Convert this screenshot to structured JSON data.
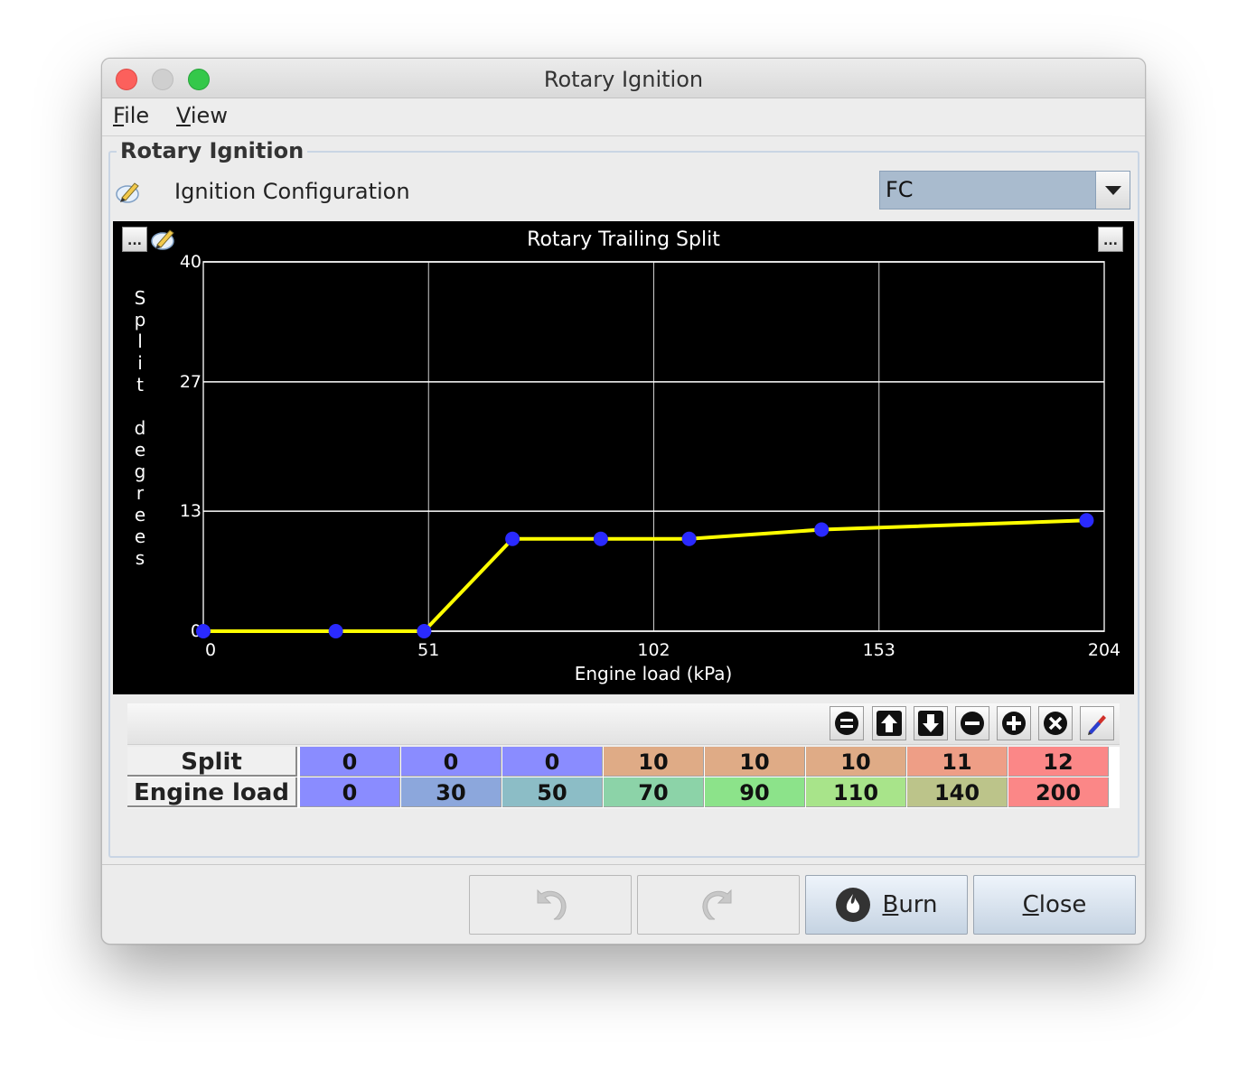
{
  "window": {
    "title": "Rotary Ignition"
  },
  "menu": {
    "items": [
      {
        "mnemonic": "F",
        "rest": "ile"
      },
      {
        "mnemonic": "V",
        "rest": "iew"
      }
    ]
  },
  "panel": {
    "legend": "Rotary Ignition",
    "config_label": "Ignition Configuration",
    "config_value": "FC",
    "config_icon": "edit-icon"
  },
  "chart_data": {
    "type": "line",
    "title": "Rotary Trailing Split",
    "xlabel": "Engine load (kPa)",
    "ylabel": "Split degrees",
    "x_ticks": [
      "0",
      "51",
      "102",
      "153",
      "204"
    ],
    "y_ticks": [
      "0",
      "13",
      "27",
      "40"
    ],
    "xlim": [
      0,
      204
    ],
    "ylim": [
      0,
      40
    ],
    "x": [
      0,
      30,
      50,
      70,
      90,
      110,
      140,
      200
    ],
    "y": [
      0,
      0,
      0,
      10,
      10,
      10,
      11,
      12
    ],
    "line_color": "#ffff00",
    "point_color": "#2a2aff",
    "grid": true
  },
  "toolbar": {
    "icons": [
      "equals-icon",
      "arrow-up-icon",
      "arrow-down-icon",
      "minus-icon",
      "plus-icon",
      "x-icon",
      "pencil-icon"
    ]
  },
  "table": {
    "rows": [
      {
        "label": "Split",
        "values": [
          "0",
          "0",
          "0",
          "10",
          "10",
          "10",
          "11",
          "12"
        ],
        "colors": [
          "#8a8cff",
          "#8a8cff",
          "#8a8cff",
          "#dfab86",
          "#dfab86",
          "#dfab86",
          "#ee9e86",
          "#fb8787"
        ]
      },
      {
        "label": "Engine load",
        "values": [
          "0",
          "30",
          "50",
          "70",
          "90",
          "110",
          "140",
          "200"
        ],
        "colors": [
          "#8a8cff",
          "#8ca7dc",
          "#8cbdc6",
          "#8cd3a8",
          "#8ce38a",
          "#a8e48a",
          "#bcc48a",
          "#fb8787"
        ]
      }
    ]
  },
  "buttons": {
    "undo": "undo-icon",
    "redo": "redo-icon",
    "burn": {
      "mnemonic": "B",
      "rest": "urn"
    },
    "close": {
      "mnemonic": "C",
      "rest": "lose"
    }
  }
}
